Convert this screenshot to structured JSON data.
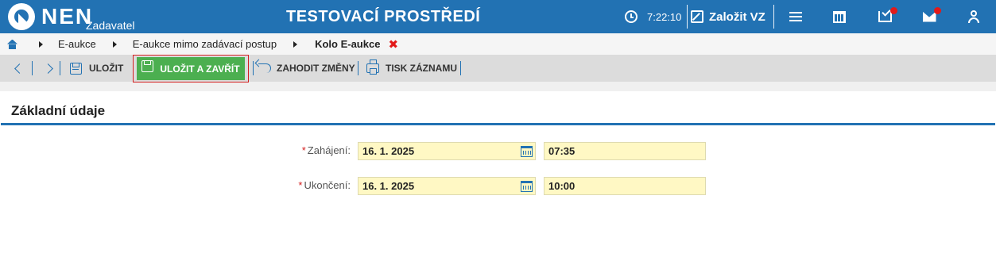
{
  "header": {
    "logo_text": "NEN",
    "logo_sub": "Zadavatel",
    "env_title": "TESTOVACÍ PROSTŘEDÍ",
    "time": "7:22:10",
    "create_label": "Založit VZ"
  },
  "breadcrumb": {
    "items": [
      "E-aukce",
      "E-aukce mimo zadávací postup"
    ],
    "current": "Kolo E-aukce",
    "close": "✖"
  },
  "toolbar": {
    "save": "ULOŽIT",
    "save_close": "ULOŽIT A ZAVŘÍT",
    "discard": "ZAHODIT ZMĚNY",
    "print": "TISK ZÁZNAMU"
  },
  "section": {
    "title": "Základní údaje",
    "fields": [
      {
        "label": "Zahájení:",
        "date": "16. 1. 2025",
        "time": "07:35"
      },
      {
        "label": "Ukončení:",
        "date": "16. 1. 2025",
        "time": "10:00"
      }
    ]
  },
  "colors": {
    "header_blue": "#2272b3",
    "field_yellow": "#fff8c4",
    "save_green": "#4caf50",
    "alert_red": "#e21a1a"
  }
}
